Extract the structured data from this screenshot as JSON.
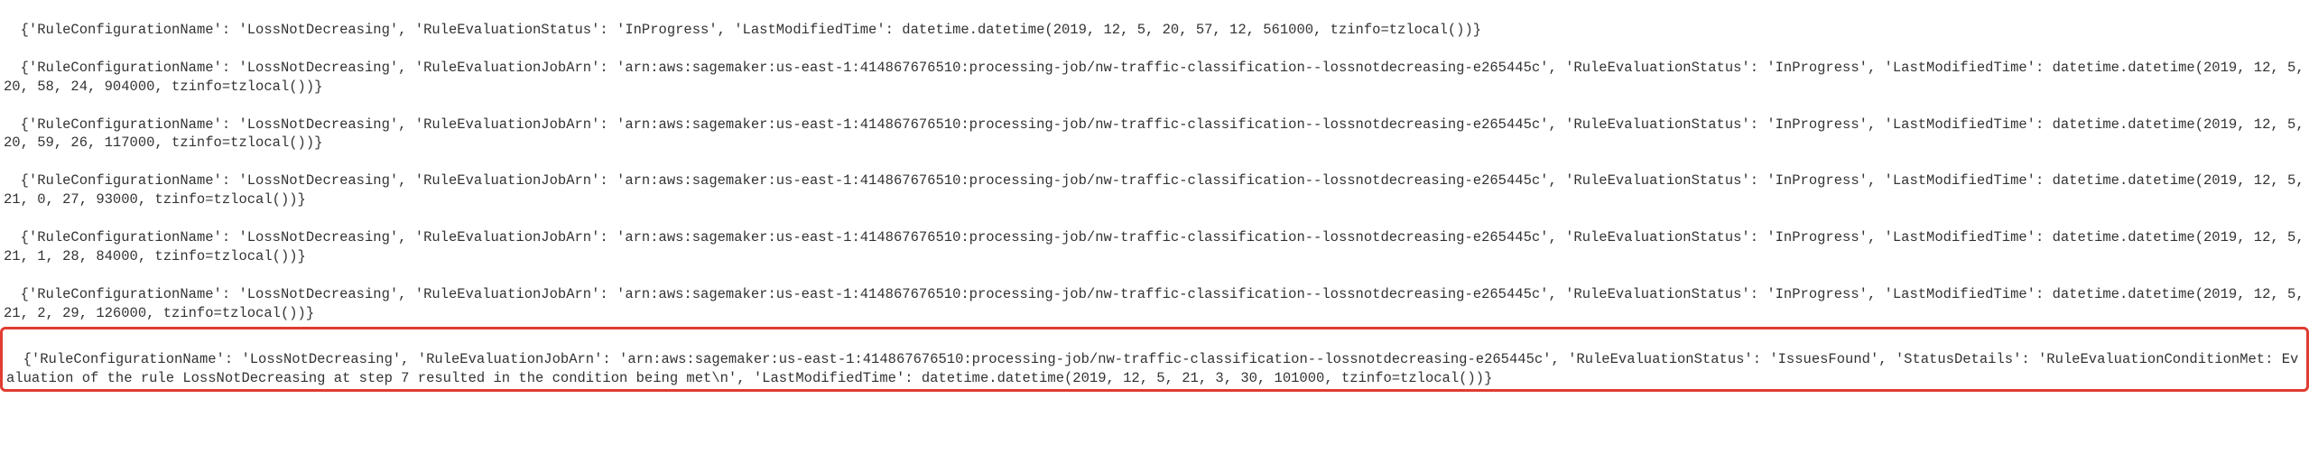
{
  "log": {
    "lines": [
      "{'RuleConfigurationName': 'LossNotDecreasing', 'RuleEvaluationStatus': 'InProgress', 'LastModifiedTime': datetime.datetime(2019, 12, 5, 20, 57, 12, 561000, tzinfo=tzlocal())}",
      "{'RuleConfigurationName': 'LossNotDecreasing', 'RuleEvaluationJobArn': 'arn:aws:sagemaker:us-east-1:414867676510:processing-job/nw-traffic-classification--lossnotdecreasing-e265445c', 'RuleEvaluationStatus': 'InProgress', 'LastModifiedTime': datetime.datetime(2019, 12, 5, 20, 58, 24, 904000, tzinfo=tzlocal())}",
      "{'RuleConfigurationName': 'LossNotDecreasing', 'RuleEvaluationJobArn': 'arn:aws:sagemaker:us-east-1:414867676510:processing-job/nw-traffic-classification--lossnotdecreasing-e265445c', 'RuleEvaluationStatus': 'InProgress', 'LastModifiedTime': datetime.datetime(2019, 12, 5, 20, 59, 26, 117000, tzinfo=tzlocal())}",
      "{'RuleConfigurationName': 'LossNotDecreasing', 'RuleEvaluationJobArn': 'arn:aws:sagemaker:us-east-1:414867676510:processing-job/nw-traffic-classification--lossnotdecreasing-e265445c', 'RuleEvaluationStatus': 'InProgress', 'LastModifiedTime': datetime.datetime(2019, 12, 5, 21, 0, 27, 93000, tzinfo=tzlocal())}",
      "{'RuleConfigurationName': 'LossNotDecreasing', 'RuleEvaluationJobArn': 'arn:aws:sagemaker:us-east-1:414867676510:processing-job/nw-traffic-classification--lossnotdecreasing-e265445c', 'RuleEvaluationStatus': 'InProgress', 'LastModifiedTime': datetime.datetime(2019, 12, 5, 21, 1, 28, 84000, tzinfo=tzlocal())}",
      "{'RuleConfigurationName': 'LossNotDecreasing', 'RuleEvaluationJobArn': 'arn:aws:sagemaker:us-east-1:414867676510:processing-job/nw-traffic-classification--lossnotdecreasing-e265445c', 'RuleEvaluationStatus': 'InProgress', 'LastModifiedTime': datetime.datetime(2019, 12, 5, 21, 2, 29, 126000, tzinfo=tzlocal())}"
    ],
    "highlighted": "{'RuleConfigurationName': 'LossNotDecreasing', 'RuleEvaluationJobArn': 'arn:aws:sagemaker:us-east-1:414867676510:processing-job/nw-traffic-classification--lossnotdecreasing-e265445c', 'RuleEvaluationStatus': 'IssuesFound', 'StatusDetails': 'RuleEvaluationConditionMet: Evaluation of the rule LossNotDecreasing at step 7 resulted in the condition being met\\n', 'LastModifiedTime': datetime.datetime(2019, 12, 5, 21, 3, 30, 101000, tzinfo=tzlocal())}"
  }
}
